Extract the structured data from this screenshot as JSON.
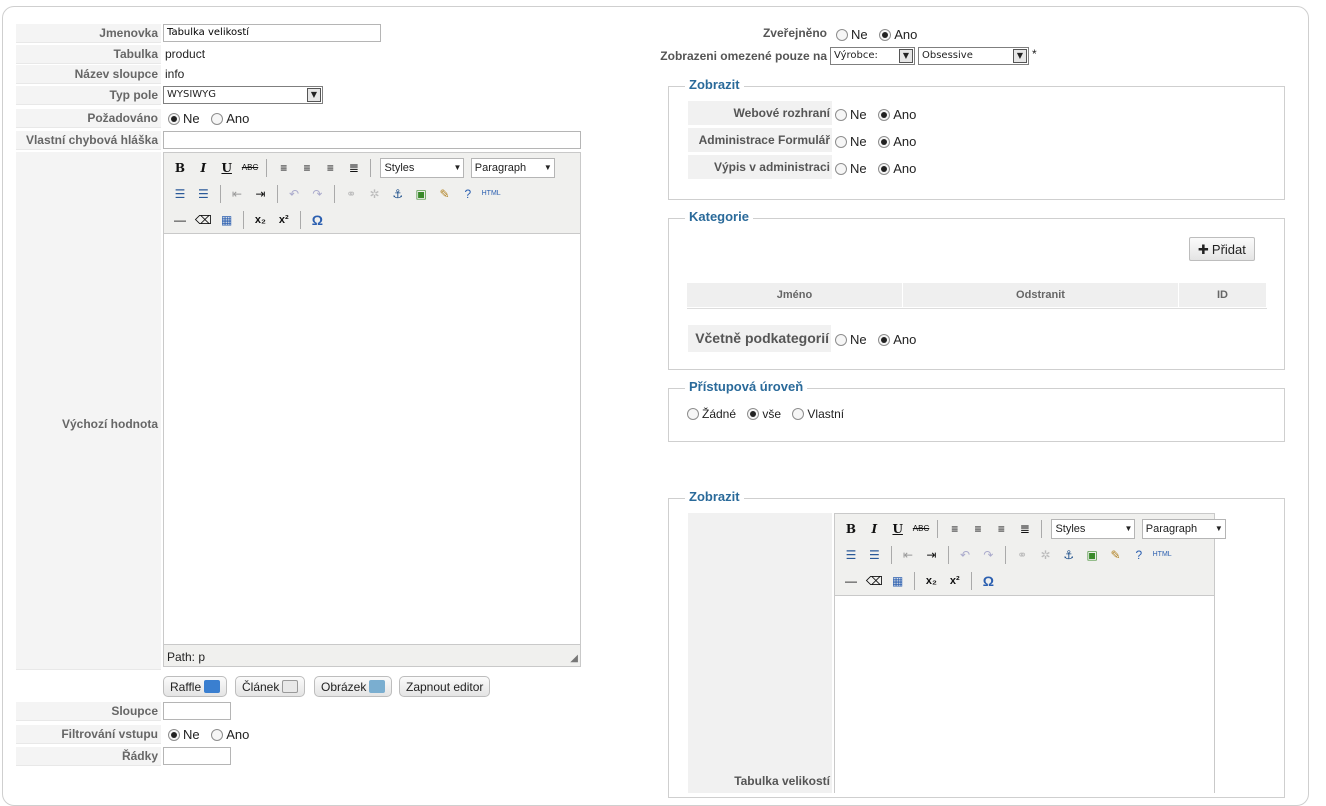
{
  "left": {
    "jmenovka": {
      "label": "Jmenovka",
      "value": "Tabulka velikostí"
    },
    "tabulka": {
      "label": "Tabulka",
      "value": "product"
    },
    "nazev": {
      "label": "Název sloupce",
      "value": "info"
    },
    "typ": {
      "label": "Typ pole",
      "value": "WYSIWYG"
    },
    "pozadovano": {
      "label": "Požadováno",
      "no": "Ne",
      "yes": "Ano",
      "selected": "Ne"
    },
    "chyba": {
      "label": "Vlastní chybová hláška",
      "value": ""
    },
    "vychozi": {
      "label": "Výchozí hodnota"
    },
    "sloupce": {
      "label": "Sloupce",
      "value": ""
    },
    "filtrovani": {
      "label": "Filtrování vstupu",
      "no": "Ne",
      "yes": "Ano",
      "selected": "Ne"
    },
    "radky": {
      "label": "Řádky",
      "value": ""
    }
  },
  "editor": {
    "styles": "Styles",
    "format": "Paragraph",
    "path": "Path: p",
    "bold": "B",
    "italic": "I",
    "underline": "U",
    "strike": "ABC",
    "html": "HTML",
    "omega": "Ω",
    "sub": "x₂",
    "sup": "x²"
  },
  "buttons": {
    "raffle": "Raffle",
    "clanek": "Článek",
    "obrazek": "Obrázek",
    "zapnout": "Zapnout editor"
  },
  "right": {
    "zverejneno": {
      "label": "Zveřejněno",
      "no": "Ne",
      "yes": "Ano",
      "selected": "Ano"
    },
    "omezene": {
      "label": "Zobrazeni omezené pouze na",
      "sel1": "Výrobce:",
      "sel2": "Obsessive",
      "star": "*"
    },
    "zobrazit1": {
      "legend": "Zobrazit",
      "rows": [
        {
          "label": "Webové rozhraní",
          "no": "Ne",
          "yes": "Ano"
        },
        {
          "label": "Administrace Formulář",
          "no": "Ne",
          "yes": "Ano"
        },
        {
          "label": "Výpis v administraci",
          "no": "Ne",
          "yes": "Ano"
        }
      ]
    },
    "kategorie": {
      "legend": "Kategorie",
      "add": "Přidat",
      "cols": [
        "Jméno",
        "Odstranit",
        "ID"
      ],
      "vcetne": {
        "label": "Včetně podkategorií",
        "no": "Ne",
        "yes": "Ano"
      }
    },
    "pristup": {
      "legend": "Přístupová úroveň",
      "opt1": "Žádné",
      "opt2": "vše",
      "opt3": "Vlastní"
    },
    "zobrazit2": {
      "legend": "Zobrazit",
      "label": "Tabulka velikostí"
    }
  },
  "colors": {
    "legend": "#2a6a9a",
    "label_bg": "#f4f4f4"
  }
}
